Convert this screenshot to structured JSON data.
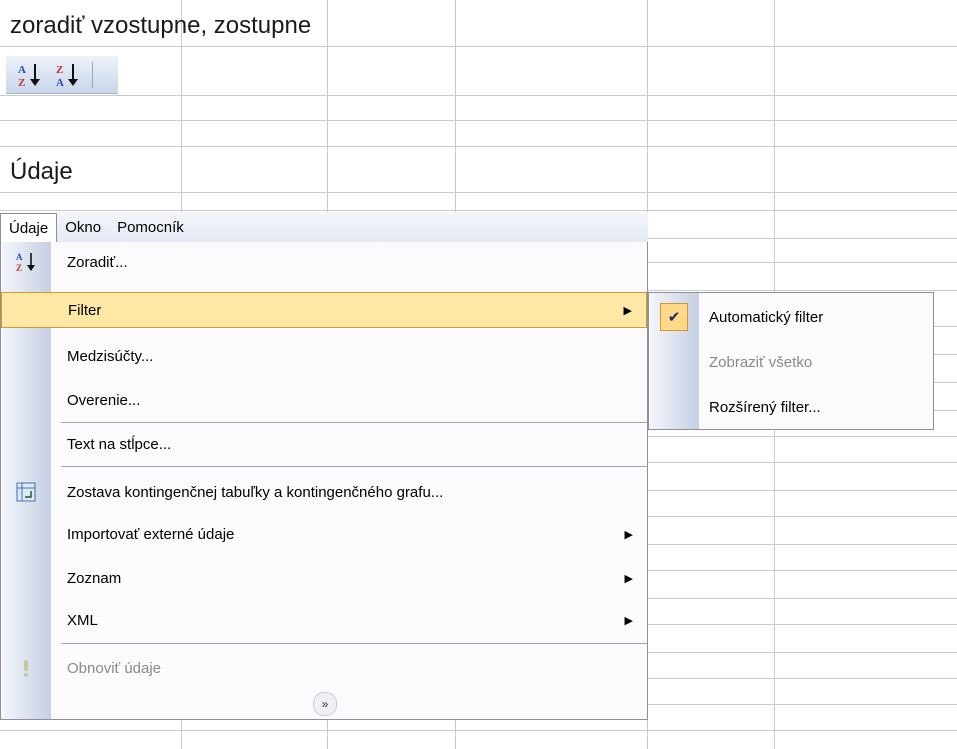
{
  "heading_sort": "zoradiť vzostupne, zostupne",
  "heading_data": "Údaje",
  "toolbar": {
    "sort_asc_icon": "sort-ascending-az-icon",
    "sort_desc_icon": "sort-descending-za-icon"
  },
  "menubar": {
    "items": [
      {
        "label": "Údaje"
      },
      {
        "label": "Okno"
      },
      {
        "label": "Pomocník"
      }
    ]
  },
  "menu": {
    "items": [
      {
        "label": "Zoradiť...",
        "icon": "sort-icon"
      },
      {
        "label": "Filter",
        "submenu": true,
        "highlighted": true
      },
      {
        "label": "Medzisúčty..."
      },
      {
        "label": "Overenie..."
      },
      {
        "label": "Text na stĺpce..."
      },
      {
        "label": "Zostava kontingenčnej tabuľky a kontingenčného grafu...",
        "icon": "pivot-table-icon"
      },
      {
        "label": "Importovať externé údaje",
        "submenu": true
      },
      {
        "label": "Zoznam",
        "submenu": true
      },
      {
        "label": "XML",
        "submenu": true
      },
      {
        "label": "Obnoviť údaje",
        "icon": "refresh-exclamation-icon",
        "disabled": true
      }
    ],
    "expand_icon": "chevron-double-down-icon"
  },
  "submenu": {
    "items": [
      {
        "label": "Automatický filter",
        "checked": true
      },
      {
        "label": "Zobraziť všetko",
        "disabled": true
      },
      {
        "label": "Rozšírený filter..."
      }
    ]
  },
  "colors": {
    "highlight": "#ffe8a6",
    "highlight_border": "#d09a2e",
    "gutter": "#c5cfe4"
  }
}
